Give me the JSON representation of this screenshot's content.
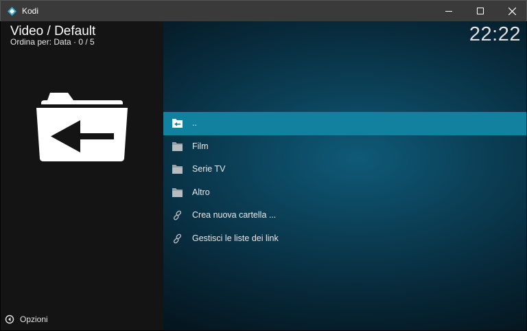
{
  "window": {
    "title": "Kodi"
  },
  "header": {
    "title": "Video / Default",
    "subtitle": "Ordina per: Data  ·  0 / 5",
    "clock": "22:22"
  },
  "list": {
    "items": [
      {
        "label": "..",
        "icon": "folder-back-icon",
        "selected": true
      },
      {
        "label": "Film",
        "icon": "folder-icon"
      },
      {
        "label": "Serie TV",
        "icon": "folder-icon"
      },
      {
        "label": "Altro",
        "icon": "folder-icon"
      },
      {
        "label": "Crea nuova cartella ...",
        "icon": "link-icon"
      },
      {
        "label": "Gestisci le liste dei link",
        "icon": "link-icon"
      }
    ]
  },
  "footer": {
    "options_label": "Opzioni"
  },
  "colors": {
    "selection": "#12809f",
    "titlebar": "#3a3a3a",
    "left_panel": "#141414"
  }
}
